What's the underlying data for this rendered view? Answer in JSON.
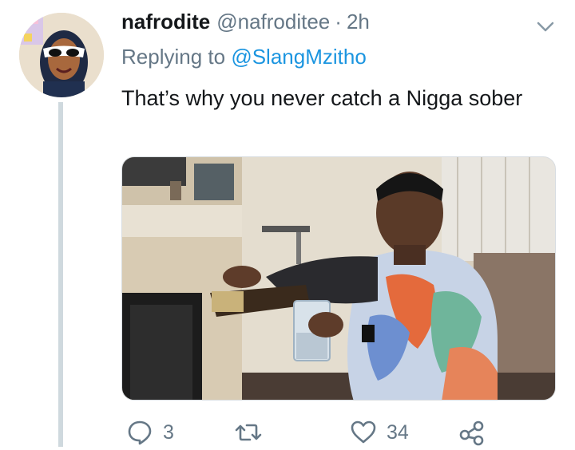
{
  "tweet": {
    "display_name": "nafrodite",
    "handle": "@nafroditee",
    "separator": "·",
    "time": "2h",
    "replying_prefix": "Replying to",
    "replying_to": "@SlangMzitho",
    "text": "That’s why you never catch a Nigga sober",
    "media_icon": "photo"
  },
  "actions": {
    "reply_count": "3",
    "retweet_count": "",
    "like_count": "34"
  },
  "icons": {
    "reply": "reply-icon",
    "retweet": "retweet-icon",
    "like": "heart-icon",
    "share": "share-icon",
    "more": "chevron-down-icon"
  },
  "colors": {
    "name": "#14171a",
    "secondary": "#657786",
    "link": "#1b95e0",
    "thread_line": "#cfd9de"
  }
}
